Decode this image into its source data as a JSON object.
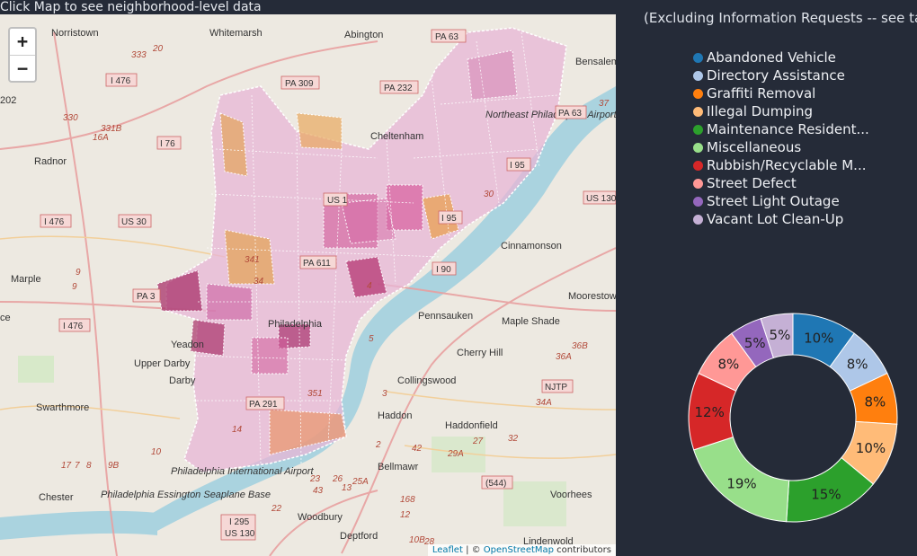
{
  "header": {
    "click_hint": "Click Map to see neighborhood-level data"
  },
  "chart_subtitle": "(Excluding Information Requests -- see ta",
  "zoom": {
    "in_label": "+",
    "out_label": "−"
  },
  "attribution": {
    "leaflet": "Leaflet",
    "sep": " | © ",
    "osm": "OpenStreetMap",
    "suffix": " contributors"
  },
  "map_labels": {
    "towns": [
      "Norristown",
      "Whitemarsh",
      "Abington",
      "Bensalem",
      "Radnor",
      "Cheltenham",
      "Cinnamonson",
      "Marple",
      "Moorestow",
      "Pennsauken",
      "Maple Shade",
      "Yeadon",
      "Upper Darby",
      "Cherry Hill",
      "Darby",
      "Collingswood",
      "Swarthmore",
      "Haddon",
      "Haddonfield",
      "Bellmawr",
      "Voorhees",
      "Chester",
      "Woodbury",
      "Deptford",
      "Lindenwold",
      "Philadelphia",
      "Northeast Philadelphia Airport",
      "Philadelphia International Airport",
      "Philadelphia Essington Seaplane Base",
      "ce",
      "202"
    ],
    "shields": [
      "PA 63",
      "I 476",
      "PA 309",
      "PA 232",
      "PA 63",
      "I 76",
      "US 1",
      "US 130",
      "I 476",
      "US 30",
      "I 95",
      "I 95",
      "PA 611",
      "I 90",
      "PA 3",
      "I 476",
      "NJTP",
      "PA 291",
      "(544)",
      "I 295",
      "US 130"
    ],
    "roads": [
      "333",
      "20",
      "331B",
      "330",
      "16A",
      "36B",
      "36A",
      "37",
      "30",
      "341",
      "34",
      "5",
      "4",
      "351",
      "9",
      "9",
      "10",
      "9B",
      "7",
      "8",
      "17",
      "23",
      "22",
      "26",
      "25A",
      "29A",
      "32",
      "34A",
      "14",
      "13",
      "12",
      "10B",
      "3",
      "27",
      "28",
      "2",
      "42",
      "43",
      "168"
    ]
  },
  "legend": [
    {
      "label": "Abandoned Vehicle",
      "color": "#1f77b4"
    },
    {
      "label": "Directory Assistance",
      "color": "#aec7e8"
    },
    {
      "label": "Graffiti Removal",
      "color": "#ff7f0e"
    },
    {
      "label": "Illegal Dumping",
      "color": "#ffbb78"
    },
    {
      "label": "Maintenance Resident...",
      "color": "#2ca02c"
    },
    {
      "label": "Miscellaneous",
      "color": "#98df8a"
    },
    {
      "label": "Rubbish/Recyclable M...",
      "color": "#d62728"
    },
    {
      "label": "Street Defect",
      "color": "#ff9896"
    },
    {
      "label": "Street Light Outage",
      "color": "#9467bd"
    },
    {
      "label": "Vacant Lot Clean-Up",
      "color": "#c5b0d5"
    }
  ],
  "chart_data": {
    "type": "pie",
    "subtype": "donut",
    "categories": [
      "Abandoned Vehicle",
      "Directory Assistance",
      "Graffiti Removal",
      "Illegal Dumping",
      "Maintenance Resident...",
      "Miscellaneous",
      "Rubbish/Recyclable M...",
      "Street Defect",
      "Street Light Outage",
      "Vacant Lot Clean-Up"
    ],
    "values": [
      10,
      8,
      8,
      10,
      15,
      19,
      12,
      8,
      5,
      5
    ],
    "labels": [
      "10%",
      "8%",
      "8%",
      "10%",
      "15%",
      "19%",
      "12%",
      "8%",
      "5%",
      "5%"
    ],
    "colors": [
      "#1f77b4",
      "#aec7e8",
      "#ff7f0e",
      "#ffbb78",
      "#2ca02c",
      "#98df8a",
      "#d62728",
      "#ff9896",
      "#9467bd",
      "#c5b0d5"
    ]
  }
}
